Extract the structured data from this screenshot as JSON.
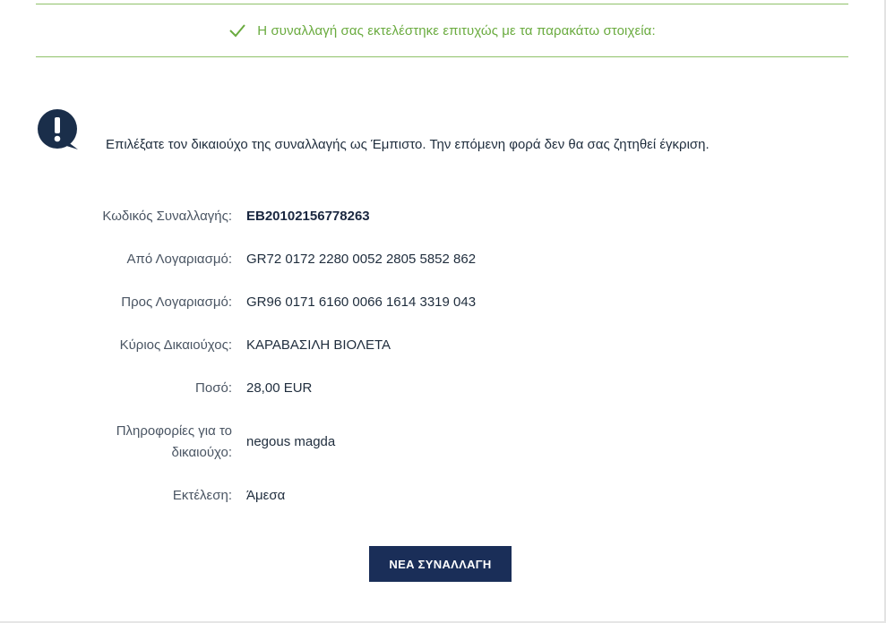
{
  "banner": {
    "message": "Η συναλλαγή σας εκτελέστηκε επιτυχώς με τα παρακάτω στοιχεία:",
    "icon": "check-icon",
    "color": "#6aab3f"
  },
  "notice": {
    "icon": "exclamation-speech-bubble-icon",
    "text": "Επιλέξατε τον δικαιούχο της συναλλαγής ως Έμπιστο. Την επόμενη φορά δεν θα σας ζητηθεί έγκριση."
  },
  "details": [
    {
      "label": "Κωδικός Συναλλαγής:",
      "value": "EB20102156778263"
    },
    {
      "label": "Από Λογαριασμό:",
      "value": "GR72 0172 2280 0052 2805 5852 862"
    },
    {
      "label": "Προς Λογαριασμό:",
      "value": "GR96 0171 6160 0066 1614 3319 043"
    },
    {
      "label": "Κύριος Δικαιούχος:",
      "value": "ΚΑΡΑΒΑΣΙΛΗ ΒΙΟΛΕΤΑ"
    },
    {
      "label": "Ποσό:",
      "value": "28,00 EUR"
    },
    {
      "label_line1": "Πληροφορίες για το",
      "label_line2": "δικαιούχο:",
      "value": "negous magda"
    },
    {
      "label": "Εκτέλεση:",
      "value": "Άμεσα"
    }
  ],
  "actions": {
    "new_transaction": "ΝΕΑ ΣΥΝΑΛΛΑΓΗ"
  },
  "colors": {
    "primary_button": "#1a2e58",
    "success": "#6aab3f",
    "icon_dark": "#1a2e4a"
  }
}
